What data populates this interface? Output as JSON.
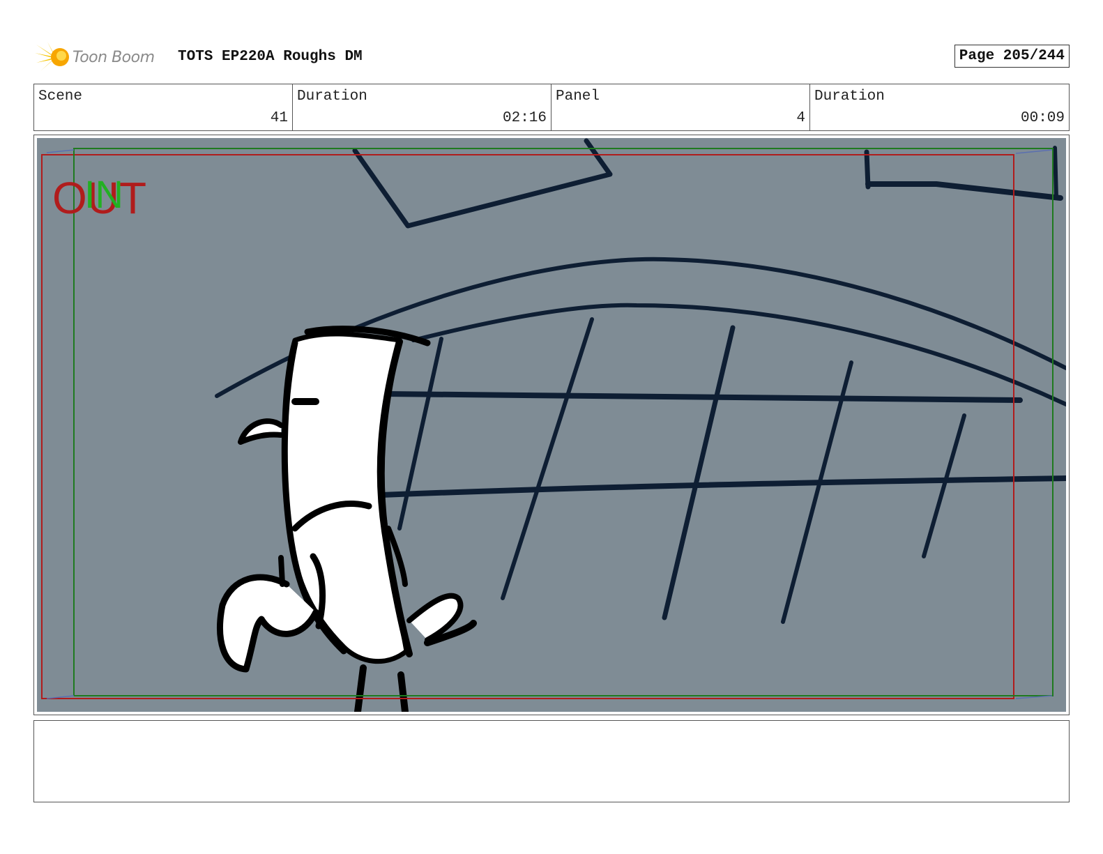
{
  "header": {
    "logo_text": "Toon Boom",
    "title": "TOTS EP220A Roughs DM",
    "page_label": "Page 205/244"
  },
  "info": {
    "scene_label": "Scene",
    "scene_value": "41",
    "scene_duration_label": "Duration",
    "scene_duration_value": "02:16",
    "panel_label": "Panel",
    "panel_value": "4",
    "panel_duration_label": "Duration",
    "panel_duration_value": "00:09"
  },
  "panel": {
    "out_label": "OUT",
    "in_label": "IN"
  },
  "notes": {
    "text": ""
  },
  "colors": {
    "panel_background": "#7f8c95",
    "sketch_line": "#0e1e33",
    "out_frame": "#b01c1c",
    "in_frame": "#1f7a1f",
    "logo_orange": "#f5b800"
  }
}
